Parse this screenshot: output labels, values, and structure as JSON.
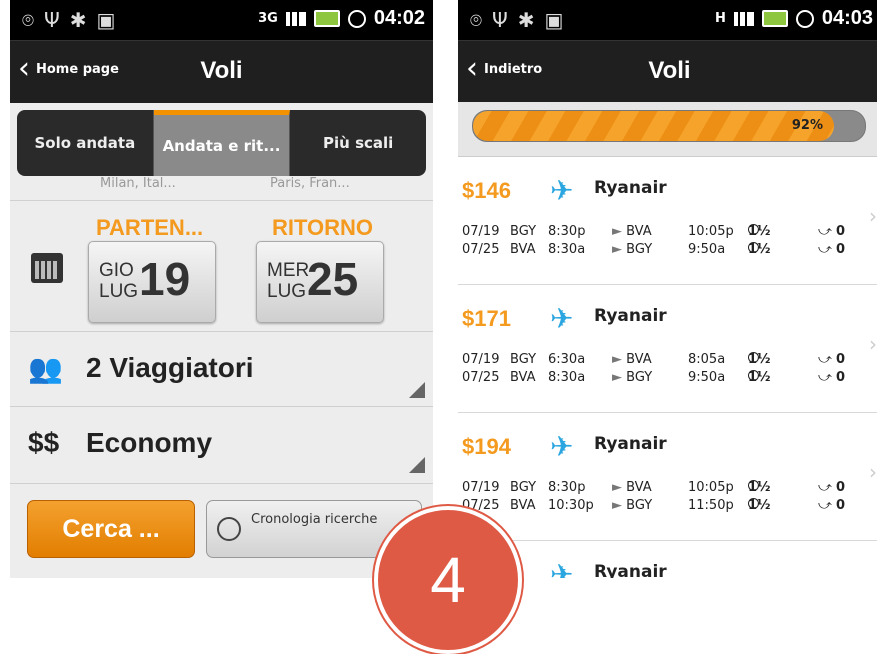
{
  "left": {
    "status": {
      "net": "3G",
      "time": "04:02"
    },
    "back": "Home page",
    "title": "Voli",
    "tabs": [
      "Solo andata",
      "Andata e rit...",
      "Più scali"
    ],
    "cities": {
      "from": "Milan, Ital...",
      "to": "Paris, Fran..."
    },
    "departure": {
      "label": "PARTEN...",
      "day": "GIO",
      "month": "LUG",
      "date": "19"
    },
    "return": {
      "label": "RITORNO",
      "day": "MER",
      "month": "LUG",
      "date": "25"
    },
    "travelers": "2 Viaggiatori",
    "class_icon": "$$",
    "class": "Economy",
    "search_button": "Cerca ...",
    "history_button": "Cronologia ricerche"
  },
  "right": {
    "status": {
      "net": "H",
      "time": "04:03"
    },
    "back": "Indietro",
    "title": "Voli",
    "progress": {
      "label": "92%",
      "value": 0.92
    },
    "flights": [
      {
        "price": "$146",
        "airline": "Ryanair",
        "legs": [
          {
            "date": "07/19",
            "from": "BGY",
            "dep": "8:30p",
            "to": "BVA",
            "arr": "10:05p",
            "dur": "1½",
            "stops": "0"
          },
          {
            "date": "07/25",
            "from": "BVA",
            "dep": "8:30a",
            "to": "BGY",
            "arr": "9:50a",
            "dur": "1½",
            "stops": "0"
          }
        ]
      },
      {
        "price": "$171",
        "airline": "Ryanair",
        "legs": [
          {
            "date": "07/19",
            "from": "BGY",
            "dep": "6:30a",
            "to": "BVA",
            "arr": "8:05a",
            "dur": "1½",
            "stops": "0"
          },
          {
            "date": "07/25",
            "from": "BVA",
            "dep": "8:30a",
            "to": "BGY",
            "arr": "9:50a",
            "dur": "1½",
            "stops": "0"
          }
        ]
      },
      {
        "price": "$194",
        "airline": "Ryanair",
        "legs": [
          {
            "date": "07/19",
            "from": "BGY",
            "dep": "8:30p",
            "to": "BVA",
            "arr": "10:05p",
            "dur": "1½",
            "stops": "0"
          },
          {
            "date": "07/25",
            "from": "BVA",
            "dep": "10:30p",
            "to": "BGY",
            "arr": "11:50p",
            "dur": "1½",
            "stops": "0"
          }
        ]
      },
      {
        "price": "",
        "airline": "Ryanair",
        "legs": []
      }
    ]
  },
  "badge": "4",
  "colors": {
    "accent": "#f39a1f",
    "badge": "#df5a45",
    "plane": "#2ca6e0"
  }
}
